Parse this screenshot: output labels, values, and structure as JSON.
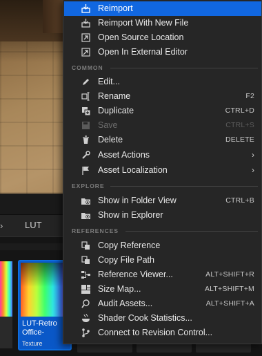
{
  "path_bar": {
    "separator": "›",
    "current_folder": "LUT"
  },
  "asset": {
    "name": "LUT-Retro Office-",
    "type": "Texture"
  },
  "menu": {
    "top_items": [
      {
        "label": "Reimport",
        "icon": "reimport-icon",
        "highlighted": true
      },
      {
        "label": "Reimport With New File",
        "icon": "reimport-new-file-icon"
      },
      {
        "label": "Open Source Location",
        "icon": "open-folder-arrow-icon"
      },
      {
        "label": "Open In External Editor",
        "icon": "external-editor-icon"
      }
    ],
    "sections": [
      {
        "title": "COMMON",
        "items": [
          {
            "label": "Edit...",
            "icon": "pencil-icon",
            "shortcut": ""
          },
          {
            "label": "Rename",
            "icon": "rename-icon",
            "shortcut": "F2"
          },
          {
            "label": "Duplicate",
            "icon": "duplicate-icon",
            "shortcut": "CTRL+D"
          },
          {
            "label": "Save",
            "icon": "save-icon",
            "shortcut": "CTRL+S",
            "disabled": true
          },
          {
            "label": "Delete",
            "icon": "trash-icon",
            "shortcut": "DELETE"
          },
          {
            "label": "Asset Actions",
            "icon": "wrench-icon",
            "submenu": true
          },
          {
            "label": "Asset Localization",
            "icon": "flag-icon",
            "submenu": true
          }
        ]
      },
      {
        "title": "EXPLORE",
        "items": [
          {
            "label": "Show in Folder View",
            "icon": "folder-search-icon",
            "shortcut": "CTRL+B"
          },
          {
            "label": "Show in Explorer",
            "icon": "folder-search-icon",
            "shortcut": ""
          }
        ]
      },
      {
        "title": "REFERENCES",
        "items": [
          {
            "label": "Copy Reference",
            "icon": "copy-reference-icon",
            "shortcut": ""
          },
          {
            "label": "Copy File Path",
            "icon": "copy-path-icon",
            "shortcut": ""
          },
          {
            "label": "Reference Viewer...",
            "icon": "reference-viewer-icon",
            "shortcut": "ALT+SHIFT+R"
          },
          {
            "label": "Size Map...",
            "icon": "size-map-icon",
            "shortcut": "ALT+SHIFT+M"
          },
          {
            "label": "Audit Assets...",
            "icon": "audit-icon",
            "shortcut": "ALT+SHIFT+A"
          },
          {
            "label": "Shader Cook Statistics...",
            "icon": "shader-stats-icon",
            "shortcut": ""
          },
          {
            "label": "Connect to Revision Control...",
            "icon": "revision-control-icon",
            "shortcut": ""
          }
        ]
      }
    ]
  },
  "colors": {
    "highlight": "#1167e0",
    "menu_bg": "#262626",
    "selection_border": "#0d6de0"
  }
}
